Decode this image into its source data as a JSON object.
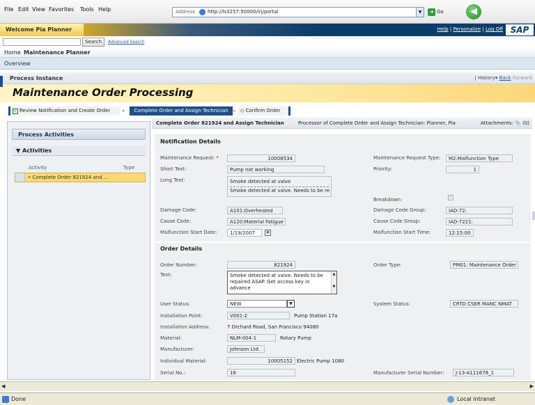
{
  "browser": {
    "menu": [
      "File",
      "Edit",
      "View",
      "Favorites",
      "Tools",
      "Help"
    ],
    "address_label": "Address",
    "url": "http://ls3257:50000/irj/portal",
    "go_label": "Go"
  },
  "portal": {
    "welcome": "Welcome Pia Planner",
    "links": [
      "Help",
      "Personalize",
      "Log Off"
    ],
    "logo": "SAP",
    "search_button": "Search",
    "advanced_search": "Advanced Search",
    "nav": [
      "Home",
      "Maintenance Planner"
    ],
    "subnav": "Overview",
    "process_instance": "Process Instance",
    "history": "History",
    "back": "Back",
    "forward": "Forward",
    "page_title": "Maintenance Order Processing"
  },
  "steps": [
    {
      "label": "Review Notification and Create Order"
    },
    {
      "label": "Complete Order and Assign Technician"
    },
    {
      "label": "Confirm Order"
    }
  ],
  "left_panel": {
    "title": "Process Activities",
    "activities_title": "Activities",
    "col_activity": "Activity",
    "col_type": "Type",
    "item": "Complete Order 821924 and ..."
  },
  "main_header": {
    "title": "Complete Order 821924 and Assign Technician",
    "processor": "Processor of Complete Order and Assign Technician: Planner, Pia",
    "attachments": "Attachments:",
    "attachments_count": "(0)"
  },
  "notification": {
    "title": "Notification Details",
    "maint_req_label": "Maintenance Request:",
    "maint_req_value": "10008534",
    "maint_type_label": "Maintenance Request Type:",
    "maint_type_value": "M2:Malfunction Type",
    "short_text_label": "Short Text:",
    "short_text_value": "Pump not working",
    "priority_label": "Priority:",
    "priority_value": "1",
    "long_text_label": "Long Text:",
    "long_text_line1": "Smoke detected at valve",
    "long_text_line2": "Smoke detected at valve. Needs to be re",
    "breakdown_label": "Breakdown:",
    "damage_code_label": "Damage Code:",
    "damage_code_value": "A101:Overheated",
    "damage_group_label": "Damage Code Group:",
    "damage_group_value": "IAD-72:",
    "cause_code_label": "Cause Code:",
    "cause_code_value": "A120:Material Fatigue",
    "cause_group_label": "Cause Code Group:",
    "cause_group_value": "IAD-7221:",
    "malf_date_label": "Malfunction Start Date:",
    "malf_date_value": "1/19/2007",
    "malf_time_label": "Malfunction Start Time:",
    "malf_time_value": "12:15:00"
  },
  "order": {
    "title": "Order Details",
    "order_number_label": "Order Number:",
    "order_number_value": "821924",
    "order_type_label": "Order Type:",
    "order_type_value": "PM01: Maintenance Order",
    "text_label": "Text:",
    "text_value": "Smoke detected at valve. Needs to be repaired ASAP. Get access key in advance",
    "user_status_label": "User Status:",
    "user_status_value": "NEW",
    "system_status_label": "System Status:",
    "system_status_value": "CRTD CSER MANC NMAT",
    "inst_point_label": "Installation Point:",
    "inst_point_value": "V001-2",
    "inst_point_desc": "Pump Station 17a",
    "inst_address_label": "Installation Address:",
    "inst_address_value": "7 Orchard Road, San Francisco 94080",
    "material_label": "Material:",
    "material_value": "NLM-004-1",
    "material_desc": "Rotary Pump",
    "manufacturer_label": "Manufacturer:",
    "manufacturer_value": "Johnson Ltd.",
    "individual_label": "Individual Material:",
    "individual_value": "10005152",
    "individual_desc": "Electric Pump 1080",
    "serial_label": "Serial No.:",
    "serial_value": "16",
    "mfr_serial_label": "Manufacturer Serial Number:",
    "mfr_serial_value": "J-13-A111678_1"
  },
  "status": {
    "done": "Done",
    "zone": "Local intranet"
  }
}
